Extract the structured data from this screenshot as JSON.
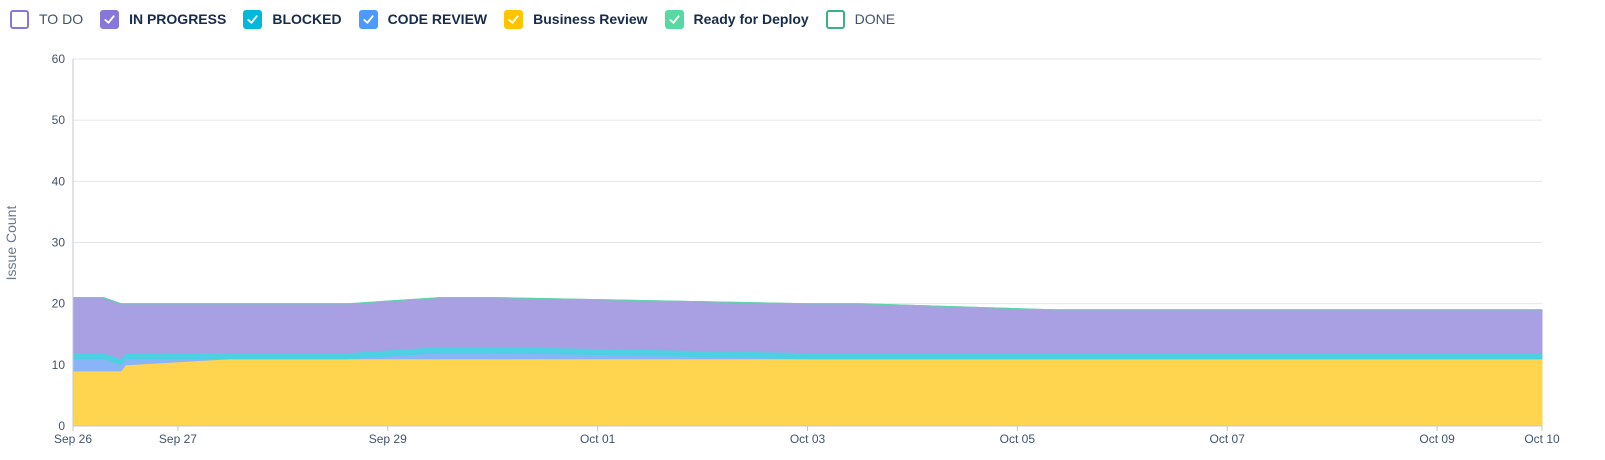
{
  "legend": [
    {
      "label": "TO DO",
      "checked": false,
      "color": "#8777d9"
    },
    {
      "label": "IN PROGRESS",
      "checked": true,
      "color": "#8777d9"
    },
    {
      "label": "BLOCKED",
      "checked": true,
      "color": "#00b8d9"
    },
    {
      "label": "CODE REVIEW",
      "checked": true,
      "color": "#4c9aff"
    },
    {
      "label": "Business Review",
      "checked": true,
      "color": "#ffc400"
    },
    {
      "label": "Ready for Deploy",
      "checked": true,
      "color": "#57d9a3"
    },
    {
      "label": "DONE",
      "checked": false,
      "color": "#36b37e"
    }
  ],
  "chart_data": {
    "type": "area",
    "stacked": true,
    "ylabel": "Issue Count",
    "xlabel": "",
    "ylim": [
      0,
      60
    ],
    "y_ticks": [
      0,
      10,
      20,
      30,
      40,
      50,
      60
    ],
    "xlim": [
      "2023-09-26",
      "2023-10-10"
    ],
    "x_ticks": [
      {
        "date": "2023-09-26",
        "label": "Sep 26"
      },
      {
        "date": "2023-09-27",
        "label": "Sep 27"
      },
      {
        "date": "2023-09-29",
        "label": "Sep 29"
      },
      {
        "date": "2023-10-01",
        "label": "Oct 01"
      },
      {
        "date": "2023-10-03",
        "label": "Oct 03"
      },
      {
        "date": "2023-10-05",
        "label": "Oct 05"
      },
      {
        "date": "2023-10-07",
        "label": "Oct 07"
      },
      {
        "date": "2023-10-09",
        "label": "Oct 09"
      },
      {
        "date": "2023-10-10",
        "label": "Oct 10"
      }
    ],
    "grid": true,
    "x": [
      "2023-09-26 00:00",
      "2023-09-26 07:00",
      "2023-09-26 11:00",
      "2023-09-26 12:00",
      "2023-09-27 12:00",
      "2023-09-28 15:00",
      "2023-09-29 12:00",
      "2023-09-30 00:00",
      "2023-10-03 00:00",
      "2023-10-03 12:00",
      "2023-10-05 08:00",
      "2023-10-10 00:00"
    ],
    "series": [
      {
        "name": "Business Review",
        "color": "#ffd54f",
        "values": [
          9,
          9,
          9,
          10,
          11,
          11,
          11,
          11,
          11,
          11,
          11,
          11
        ]
      },
      {
        "name": "CODE REVIEW",
        "color": "#8ab4f8",
        "values": [
          2,
          2,
          1,
          1,
          0,
          0,
          1,
          1,
          0,
          0,
          0,
          0
        ]
      },
      {
        "name": "BLOCKED",
        "color": "#4dd0e1",
        "values": [
          1,
          1,
          1,
          1,
          1,
          1,
          1,
          1,
          1,
          1,
          1,
          1
        ]
      },
      {
        "name": "IN PROGRESS",
        "color": "#a99fe3",
        "values": [
          9,
          9,
          9,
          8,
          8,
          8,
          8,
          8,
          8,
          8,
          7,
          7
        ]
      },
      {
        "name": "Ready for Deploy",
        "color": "#57d9a3",
        "values": [
          0,
          0,
          0,
          0,
          0,
          0,
          0,
          0,
          0,
          0,
          0,
          0
        ]
      }
    ]
  }
}
